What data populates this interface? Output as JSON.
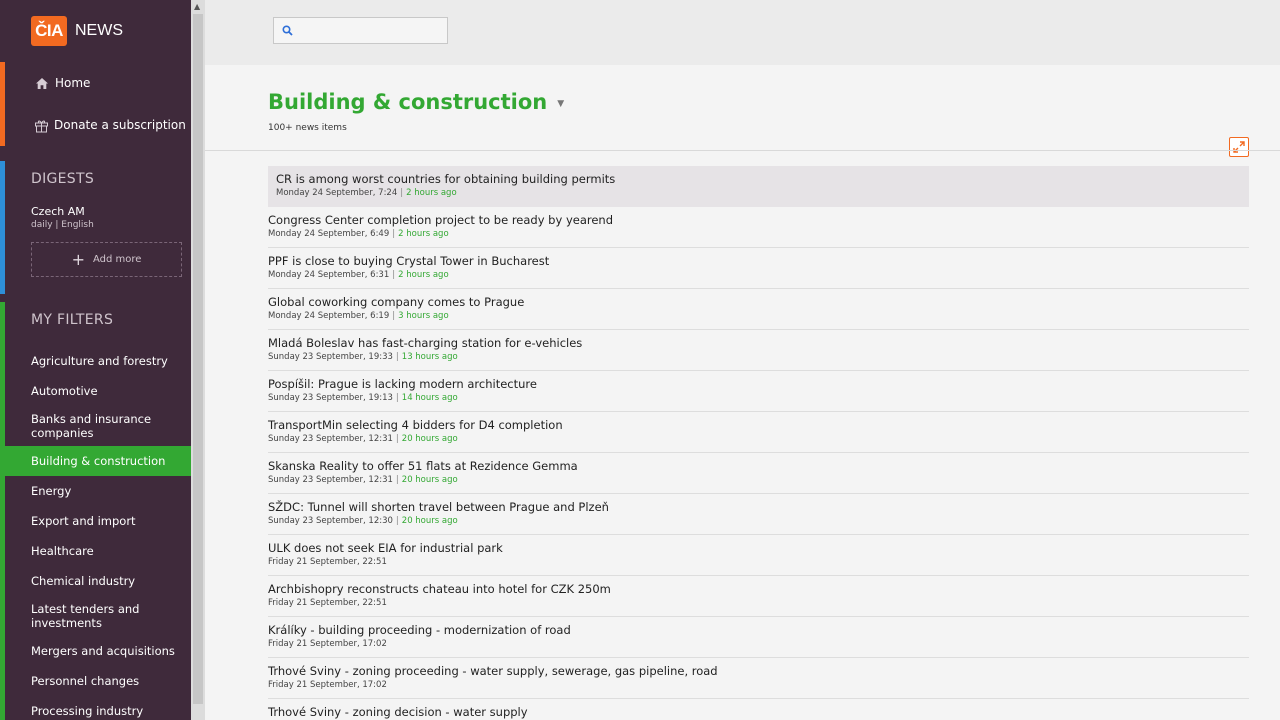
{
  "brand": {
    "logo": "ČIA",
    "name": "NEWS"
  },
  "nav": {
    "home": "Home",
    "donate": "Donate a subscription"
  },
  "digests": {
    "title": "DIGESTS",
    "item_name": "Czech AM",
    "item_meta": "daily | English",
    "add_more": "Add more"
  },
  "filters": {
    "title": "MY FILTERS",
    "items": [
      "Agriculture and forestry",
      "Automotive",
      "Banks and insurance companies",
      "Building & construction",
      "Energy",
      "Export and import",
      "Healthcare",
      "Chemical industry",
      "Latest tenders and investments",
      "Mergers and acquisitions",
      "Personnel changes",
      "Processing industry"
    ],
    "active_index": 3
  },
  "search": {
    "placeholder": ""
  },
  "category": {
    "title": "Building & construction",
    "count": "100+ news items"
  },
  "news": [
    {
      "title": "CR is among worst countries for obtaining building permits",
      "date": "Monday 24 September, 7:24",
      "ago": "2 hours ago"
    },
    {
      "title": "Congress Center completion project to be ready by yearend",
      "date": "Monday 24 September, 6:49",
      "ago": "2 hours ago"
    },
    {
      "title": "PPF is close to buying Crystal Tower in Bucharest",
      "date": "Monday 24 September, 6:31",
      "ago": "2 hours ago"
    },
    {
      "title": "Global coworking company comes to Prague",
      "date": "Monday 24 September, 6:19",
      "ago": "3 hours ago"
    },
    {
      "title": "Mladá Boleslav has fast-charging station for e-vehicles",
      "date": "Sunday 23 September, 19:33",
      "ago": "13 hours ago"
    },
    {
      "title": "Pospíšil: Prague is lacking modern architecture",
      "date": "Sunday 23 September, 19:13",
      "ago": "14 hours ago"
    },
    {
      "title": "TransportMin selecting 4 bidders for D4 completion",
      "date": "Sunday 23 September, 12:31",
      "ago": "20 hours ago"
    },
    {
      "title": "Skanska Reality to offer 51 flats at Rezidence Gemma",
      "date": "Sunday 23 September, 12:31",
      "ago": "20 hours ago"
    },
    {
      "title": "SŽDC: Tunnel will shorten travel between Prague and Plzeň",
      "date": "Sunday 23 September, 12:30",
      "ago": "20 hours ago"
    },
    {
      "title": "ULK does not seek EIA for industrial park",
      "date": "Friday 21 September, 22:51",
      "ago": ""
    },
    {
      "title": "Archbishopry reconstructs chateau into hotel for CZK 250m",
      "date": "Friday 21 September, 22:51",
      "ago": ""
    },
    {
      "title": "Králíky - building proceeding - modernization of road",
      "date": "Friday 21 September, 17:02",
      "ago": ""
    },
    {
      "title": "Trhové Sviny - zoning proceeding - water supply, sewerage, gas pipeline, road",
      "date": "Friday 21 September, 17:02",
      "ago": ""
    },
    {
      "title": "Trhové Sviny - zoning decision - water supply",
      "date": "",
      "ago": ""
    }
  ],
  "colors": {
    "sidebar": "#3f2a3b",
    "brand_orange": "#f26a21",
    "digest_blue": "#2e8fd8",
    "accent_green": "#33a833"
  },
  "icons": {
    "home": "home-icon",
    "gift": "gift-icon",
    "search": "search-icon",
    "expand": "expand-icon",
    "dropdown": "caret-down-icon"
  }
}
